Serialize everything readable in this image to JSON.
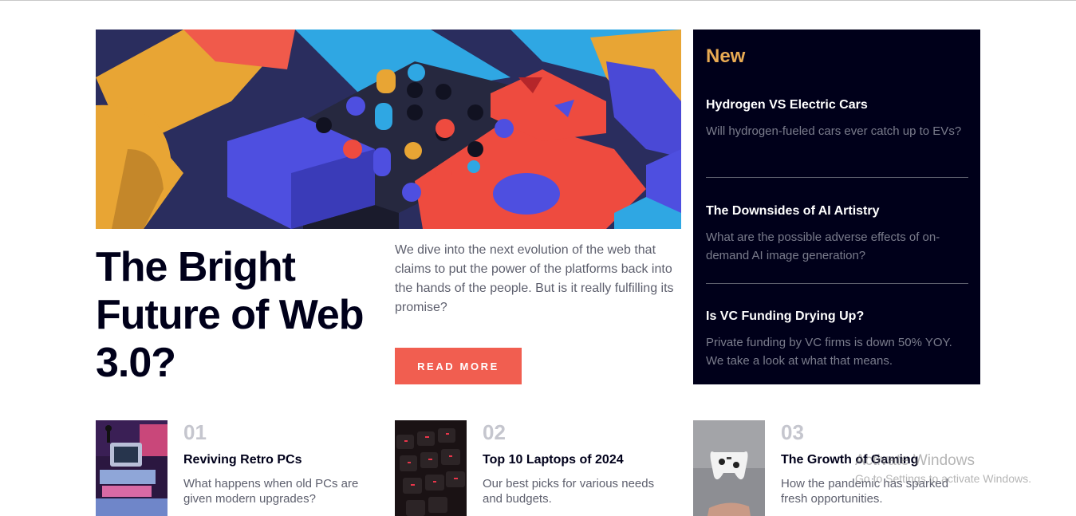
{
  "hero": {
    "image_icon": "abstract-3d-blocks-image",
    "title": "The Bright Future of Web 3.0?",
    "description": "We dive into the next evolution of the web that claims to put the power of the platforms back into the hands of the people. But is it really fulfilling its promise?",
    "read_more_label": "READ MORE"
  },
  "new_panel": {
    "heading": "New",
    "items": [
      {
        "title": "Hydrogen VS Electric Cars",
        "description": "Will hydrogen-fueled cars ever catch up to EVs?"
      },
      {
        "title": "The Downsides of AI Artistry",
        "description": "What are the possible adverse effects of on-demand AI image generation?"
      },
      {
        "title": "Is VC Funding Drying Up?",
        "description": "Private funding by VC firms is down 50% YOY. We take a look at what that means."
      }
    ]
  },
  "top_articles": [
    {
      "number": "01",
      "title": "Reviving Retro PCs",
      "description": "What happens when old PCs are given modern upgrades?",
      "thumb_icon": "retro-pc-image"
    },
    {
      "number": "02",
      "title": "Top 10 Laptops of 2024",
      "description": "Our best picks for various needs and budgets.",
      "thumb_icon": "laptop-keyboard-image"
    },
    {
      "number": "03",
      "title": "The Growth of Gaming",
      "description": "How the pandemic has sparked fresh opportunities.",
      "thumb_icon": "game-controller-image"
    }
  ],
  "watermark": {
    "line1": "Activate Windows",
    "line2": "Go to Settings to activate Windows."
  },
  "colors": {
    "accent": "#f15e50",
    "panel_bg": "#00001a",
    "new_heading": "#e9ab53"
  }
}
